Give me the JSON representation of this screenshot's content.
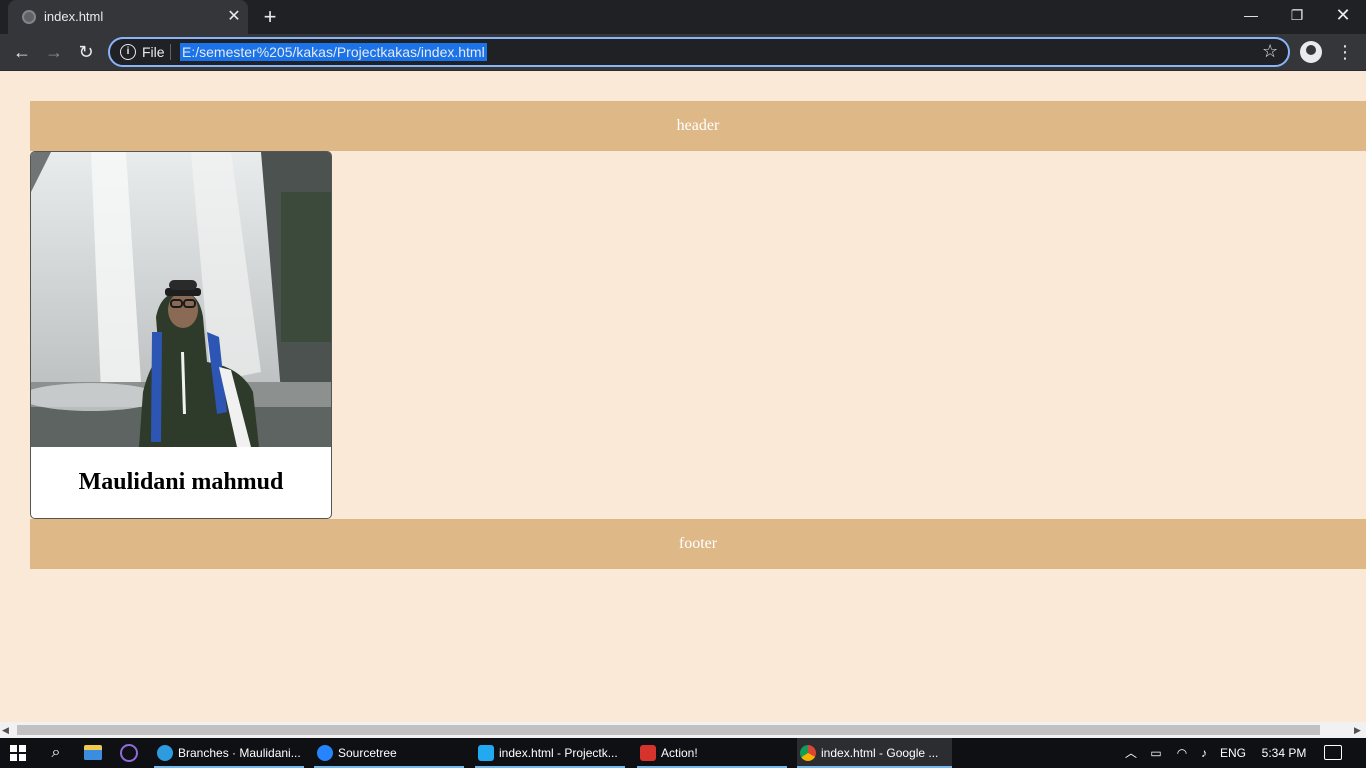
{
  "browser": {
    "tab_title": "index.html",
    "tab_close": "✕",
    "new_tab": "+",
    "scheme_label": "File",
    "url": "E:/semester%205/kakas/Projectkakas/index.html",
    "nav": {
      "back": "←",
      "forward": "→",
      "reload": "↻"
    },
    "window": {
      "minimize": "—",
      "maximize": "❐",
      "close": "✕"
    },
    "star": "☆",
    "menu": "⋮",
    "icons": [
      "globe-icon",
      "info-icon",
      "star-icon",
      "account-icon",
      "kebab-menu-icon"
    ]
  },
  "page": {
    "header_text": "header",
    "card_name": "Maulidani mahmud",
    "footer_text": "footer",
    "colors": {
      "background": "#fae9d7",
      "bar": "#deb887",
      "bar_text": "#ffffff"
    }
  },
  "taskbar": {
    "tasks": [
      {
        "label": "Branches · Maulidani...",
        "icon": "edge-icon"
      },
      {
        "label": "Sourcetree",
        "icon": "sourcetree-icon"
      },
      {
        "label": "index.html - Projectk...",
        "icon": "vscode-icon"
      },
      {
        "label": "Action!",
        "icon": "action-icon"
      },
      {
        "label": "index.html - Google ...",
        "icon": "chrome-icon"
      }
    ],
    "language": "ENG",
    "time": "5:34 PM"
  }
}
